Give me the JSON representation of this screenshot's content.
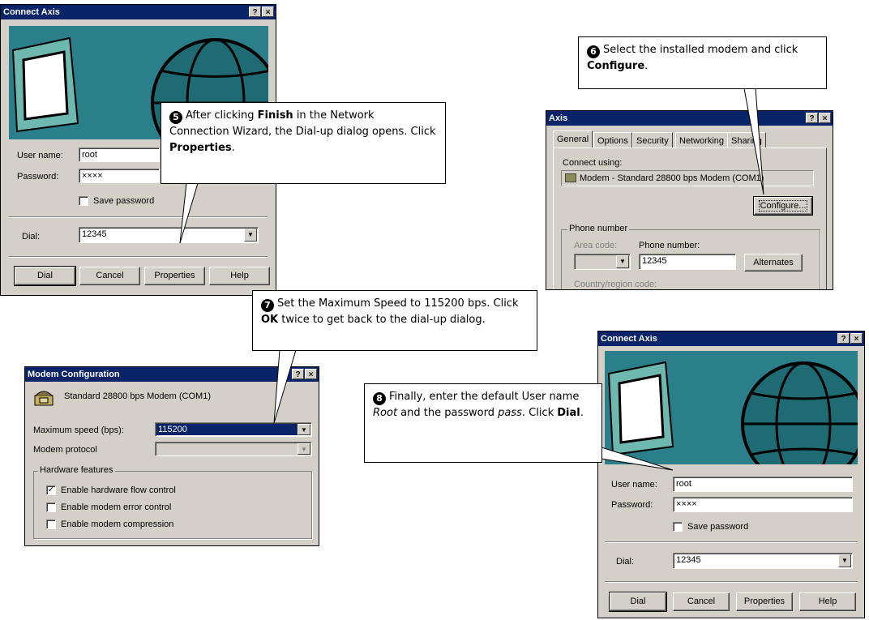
{
  "dialog1": {
    "title": "Connect Axis",
    "help_btn": "?",
    "close_btn": "×",
    "user_name_label": "User name:",
    "user_name_value": "root",
    "password_label": "Password:",
    "password_value": "××××",
    "save_password_label": "Save password",
    "dial_label": "Dial:",
    "dial_value": "12345",
    "buttons": {
      "dial": "Dial",
      "cancel": "Cancel",
      "properties": "Properties",
      "help": "Help"
    }
  },
  "callout5": {
    "num": "5",
    "t1": "After clicking ",
    "b1": "Finish",
    "t2": " in the Network Connection Wizard, the Dial-up dialog opens. Click ",
    "b2": "Properties",
    "t3": "."
  },
  "callout6": {
    "num": "6",
    "t1": "Select the installed modem and click ",
    "b1": "Configure",
    "t2": "."
  },
  "dialog2": {
    "title": "Axis",
    "help_btn": "?",
    "close_btn": "×",
    "tabs": [
      "General",
      "Options",
      "Security",
      "Networking",
      "Sharing"
    ],
    "connect_using_label": "Connect using:",
    "modem_name": "Modem - Standard 28800 bps Modem (COM1)",
    "configure_btn": "Configure...",
    "phone_group_label": "Phone number",
    "area_code_label": "Area code:",
    "phone_number_label": "Phone number:",
    "phone_number_value": "12345",
    "alternates_btn": "Alternates",
    "country_label": "Country/region code:"
  },
  "callout7": {
    "num": "7",
    "t1": "Set the Maximum Speed to 115200 bps. Click ",
    "b1": "OK",
    "t2": " twice to get back to the dial-up dialog."
  },
  "dialog3": {
    "title": "Modem Configuration",
    "help_btn": "?",
    "close_btn": "×",
    "modem_name": "Standard 28800 bps Modem (COM1)",
    "max_speed_label": "Maximum speed (bps):",
    "max_speed_value": "115200",
    "modem_protocol_label": "Modem protocol",
    "hardware_group_label": "Hardware features",
    "check_flow": "Enable hardware flow control",
    "check_error": "Enable modem error control",
    "check_compression": "Enable modem compression",
    "check_mark": "✓"
  },
  "callout8": {
    "num": "8",
    "t1": "Finally, enter the default User name ",
    "i1": "Root",
    "t2": " and the password ",
    "i2": "pass",
    "t3": ". Click ",
    "b1": "Dial",
    "t4": "."
  },
  "dialog4": {
    "title": "Connect Axis",
    "help_btn": "?",
    "close_btn": "×",
    "user_name_label": "User name:",
    "user_name_value": "root",
    "password_label": "Password:",
    "password_value": "××××",
    "save_password_label": "Save password",
    "dial_label": "Dial:",
    "dial_value": "12345",
    "buttons": {
      "dial": "Dial",
      "cancel": "Cancel",
      "properties": "Properties",
      "help": "Help"
    }
  },
  "icons": {
    "dropdown": "▼"
  },
  "colors": {
    "titlebar": "#0a246a",
    "dialog_bg": "#d4d0c8",
    "banner": "#2a7f8a",
    "selection": "#0a246a"
  }
}
